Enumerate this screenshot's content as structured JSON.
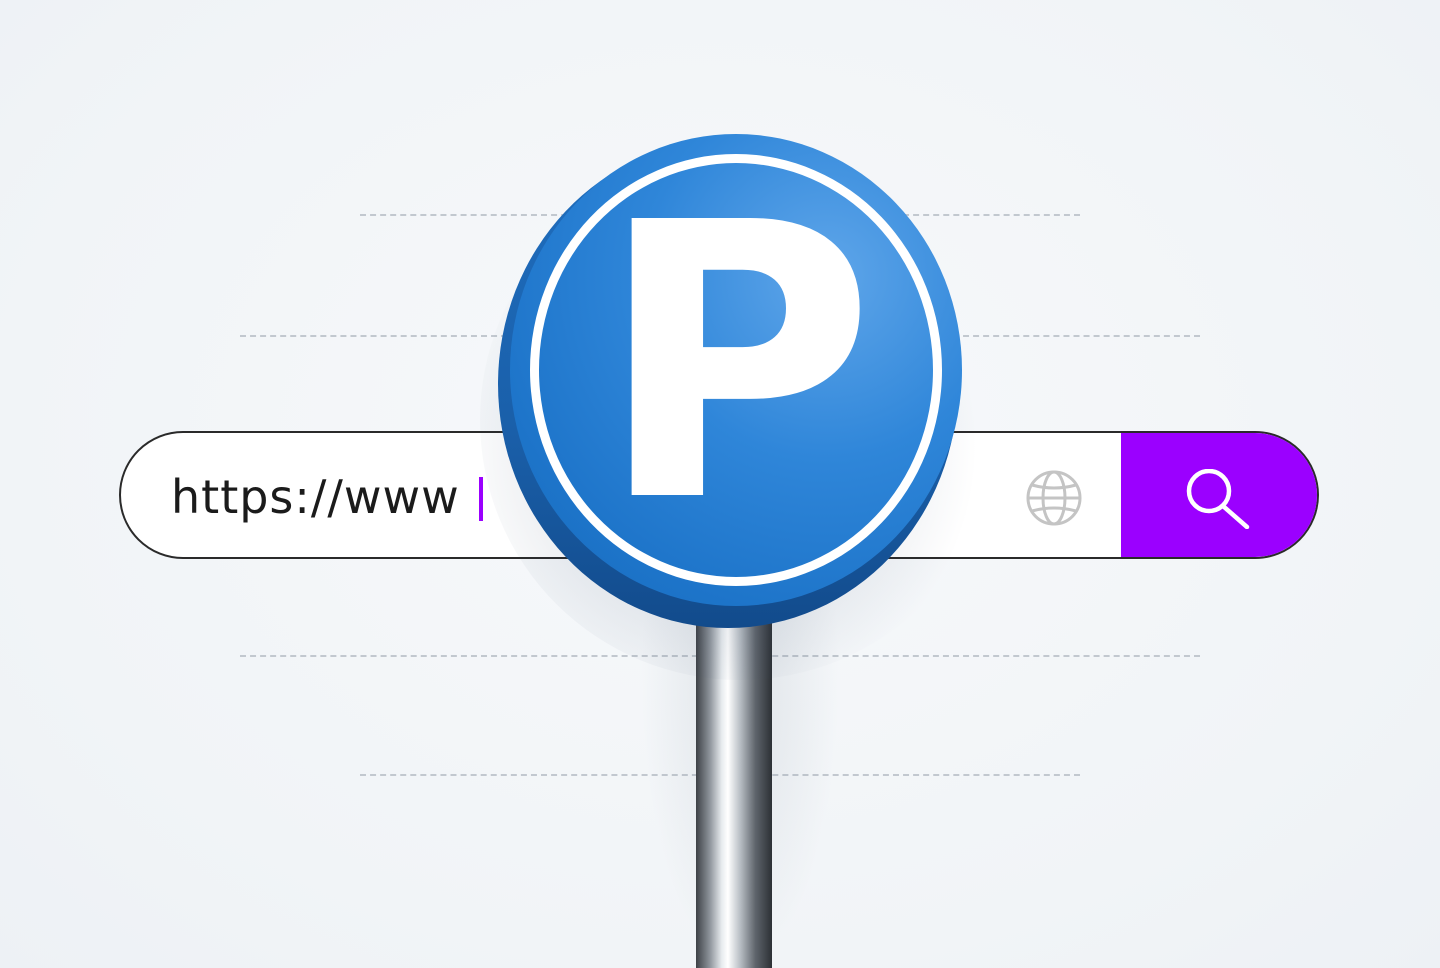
{
  "address_bar": {
    "url_text": "https://www",
    "globe_icon": "globe-icon",
    "search_icon": "search-icon"
  },
  "parking_sign": {
    "letter": "P"
  },
  "colors": {
    "accent": "#9b00ff",
    "sign_blue": "#1d74c9",
    "background": "#f3f6f9"
  }
}
